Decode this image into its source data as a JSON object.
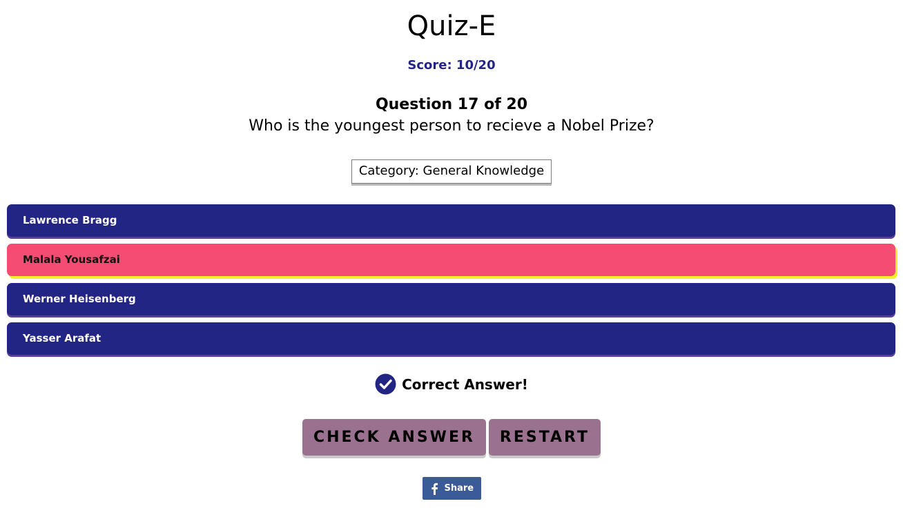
{
  "app": {
    "title": "Quiz-E"
  },
  "score": {
    "text": "Score: 10/20"
  },
  "question": {
    "number_text": "Question 17 of 20",
    "text": "Who is the youngest person to recieve a Nobel Prize?",
    "category_text": "Category: General Knowledge"
  },
  "answers": [
    {
      "label": "Lawrence Bragg",
      "selected": false
    },
    {
      "label": "Malala Yousafzai",
      "selected": true
    },
    {
      "label": "Werner Heisenberg",
      "selected": false
    },
    {
      "label": "Yasser Arafat",
      "selected": false
    }
  ],
  "feedback": {
    "text": "Correct Answer!",
    "icon": "check-circle-icon"
  },
  "buttons": {
    "check_label": "CHECK ANSWER",
    "restart_label": "RESTART"
  },
  "share": {
    "label": "Share",
    "icon": "facebook-icon"
  },
  "colors": {
    "primary": "#232584",
    "selected": "#f44c72",
    "selected_outline": "#f5ee2a",
    "button": "#9a728f",
    "facebook": "#3b5a98"
  }
}
